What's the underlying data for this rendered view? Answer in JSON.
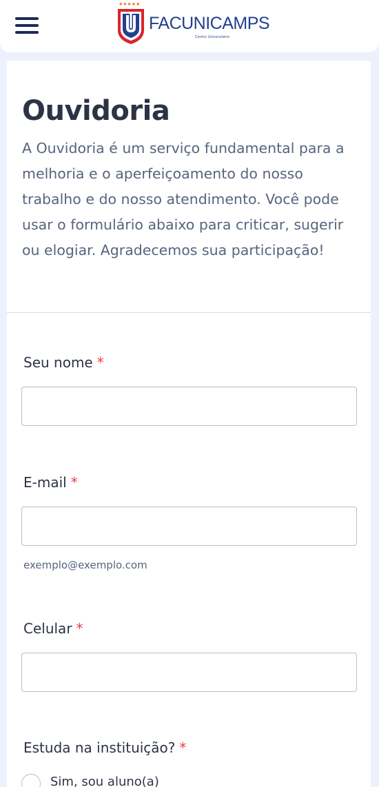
{
  "header": {
    "menu_icon": "hamburger-menu-icon",
    "logo_text": "FACUNICAMPS",
    "logo_subtext": "Centro Universitário",
    "logo_stars": "★★★★★",
    "colors": {
      "brand_blue": "#23408e",
      "brand_red": "#d8262f",
      "star_orange": "#e8731b"
    }
  },
  "form": {
    "title": "Ouvidoria",
    "intro": "A Ouvidoria é um serviço fundamental para a melhoria e o aperfeiçoamento do nosso trabalho e do nosso atendimento. Você pode usar o formulário abaixo para criticar, sugerir ou elogiar. Agradecemos sua participação!",
    "required_mark": "*",
    "fields": {
      "name": {
        "label": "Seu nome",
        "value": ""
      },
      "email": {
        "label": "E-mail",
        "value": "",
        "sublabel": "exemplo@exemplo.com"
      },
      "phone": {
        "label": "Celular",
        "value": ""
      },
      "student": {
        "label": "Estuda na instituição?",
        "options": [
          "Sim, sou aluno(a)"
        ]
      }
    },
    "colors": {
      "required": "#f23a3c",
      "text": "#2c3345",
      "muted": "#57647e",
      "border": "#b8bdc9",
      "page_bg": "#eef0fb"
    }
  }
}
